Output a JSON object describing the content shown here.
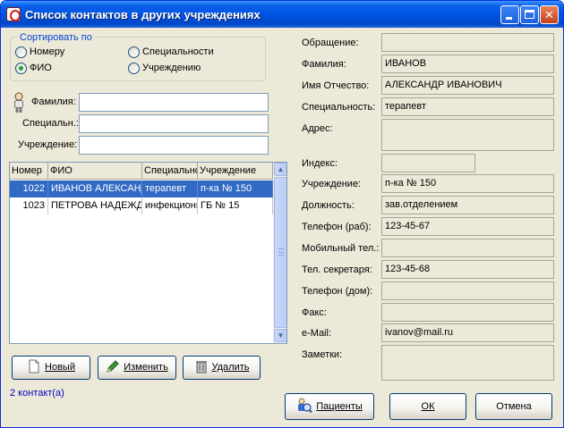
{
  "window": {
    "title": "Список контактов в других учреждениях"
  },
  "sort": {
    "legend": "Сортировать по",
    "options": [
      {
        "label": "Номеру",
        "checked": false
      },
      {
        "label": "Специальности",
        "checked": false
      },
      {
        "label": "ФИО",
        "checked": true
      },
      {
        "label": "Учреждению",
        "checked": false
      }
    ]
  },
  "filters": {
    "surname_label": "Фамилия:",
    "surname_value": "",
    "specialty_label": "Специальн.:",
    "specialty_value": "",
    "institution_label": "Учреждение:",
    "institution_value": ""
  },
  "grid": {
    "columns": [
      "Номер",
      "ФИО",
      "Специальность",
      "Учреждение"
    ],
    "rows": [
      {
        "num": "1022",
        "fio": "ИВАНОВ АЛЕКСАНДР ИВАНОВИЧ",
        "spec": "терапевт",
        "inst": "п-ка № 150",
        "selected": true
      },
      {
        "num": "1023",
        "fio": "ПЕТРОВА НАДЕЖДА",
        "spec": "инфекционист",
        "inst": "ГБ № 15",
        "selected": false
      }
    ]
  },
  "buttons": {
    "new": "Новый",
    "edit": "Изменить",
    "delete": "Удалить",
    "patients": "Пациенты",
    "ok": "ОК",
    "cancel": "Отмена"
  },
  "status": "2 контакт(а)",
  "details": {
    "salutation_label": "Обращение:",
    "salutation": "",
    "surname_label": "Фамилия:",
    "surname": "ИВАНОВ",
    "name_label": "Имя Отчество:",
    "name": "АЛЕКСАНДР ИВАНОВИЧ",
    "specialty_label": "Специальность:",
    "specialty": "терапевт",
    "address_label": "Адрес:",
    "address": "",
    "index_label": "Индекс:",
    "index": "",
    "institution_label": "Учреждение:",
    "institution": "п-ка № 150",
    "position_label": "Должность:",
    "position": "зав.отделением",
    "phone_work_label": "Телефон (раб):",
    "phone_work": "123-45-67",
    "mobile_label": "Мобильный тел.:",
    "mobile": "",
    "secretary_label": "Тел. секретаря:",
    "secretary": "123-45-68",
    "phone_home_label": "Телефон (дом):",
    "phone_home": "",
    "fax_label": "Факс:",
    "fax": "",
    "email_label": "e-Mail:",
    "email": "ivanov@mail.ru",
    "notes_label": "Заметки:",
    "notes": ""
  }
}
